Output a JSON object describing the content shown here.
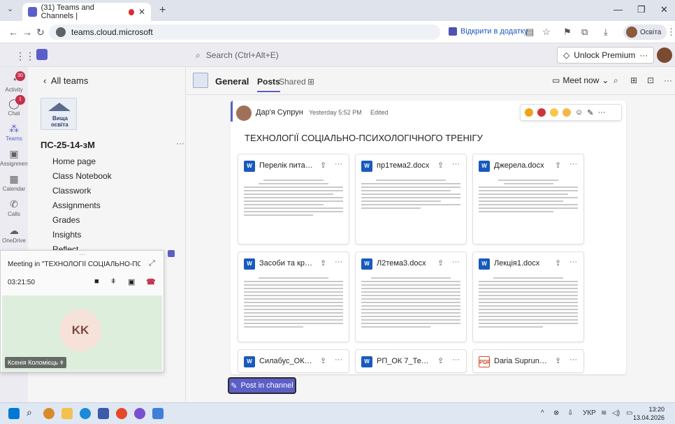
{
  "browser": {
    "tab_title": "(31) Teams and Channels |",
    "url": "teams.cloud.microsoft",
    "open_in_app": "Відкрити в додатку",
    "profile_name": "Освіта"
  },
  "teams": {
    "search_placeholder": "Search (Ctrl+Alt+E)",
    "premium_label": "Unlock Premium"
  },
  "rail": {
    "items": [
      {
        "label": "Activity",
        "badge": "30"
      },
      {
        "label": "Chat",
        "badge": "1"
      },
      {
        "label": "Teams"
      },
      {
        "label": "Assignments"
      },
      {
        "label": "Calendar"
      },
      {
        "label": "Calls"
      },
      {
        "label": "OneDrive"
      }
    ]
  },
  "left": {
    "back_label": "All teams",
    "logo_line1": "Вища",
    "logo_line2": "освіта",
    "team_name": "ПС-25-14-зМ",
    "nav": [
      "Home page",
      "Class Notebook",
      "Classwork",
      "Assignments",
      "Grades",
      "Insights",
      "Reflect"
    ]
  },
  "meeting": {
    "title": "Meeting in \"ТЕХНОЛОГІЇ СОЦІАЛЬНО-ПСИХ...",
    "timer": "03:21:50",
    "initials": "KK",
    "participant": "Ксенія Коломієць"
  },
  "channel": {
    "name": "General",
    "tabs": [
      "Posts",
      "Shared"
    ],
    "meet_now": "Meet now"
  },
  "post": {
    "author": "Дар'я Супрун",
    "time": "Yesterday 5:52 PM",
    "edited": "Edited",
    "title": "ТЕХНОЛОГІЇ СОЦІАЛЬНО-ПСИХОЛОГІЧНОГО ТРЕНІГУ",
    "files": [
      {
        "name": "Перелік питан...",
        "type": "W"
      },
      {
        "name": "пр1тема2.docx",
        "type": "W"
      },
      {
        "name": "Джерела.docx",
        "type": "W"
      },
      {
        "name": "Засоби та крит...",
        "type": "W"
      },
      {
        "name": "Л2тема3.docx",
        "type": "W"
      },
      {
        "name": "Лекція1.docx",
        "type": "W"
      },
      {
        "name": "Силабус_ОК 7_...",
        "type": "W"
      },
      {
        "name": "РП_ОК 7_Техно...",
        "type": "W"
      },
      {
        "name": "Daria Suprun C...",
        "type": "PDF"
      }
    ]
  },
  "post_button": "Post in channel",
  "taskbar": {
    "lang": "УКР",
    "time": "13:20",
    "date": "13.04.2026"
  }
}
